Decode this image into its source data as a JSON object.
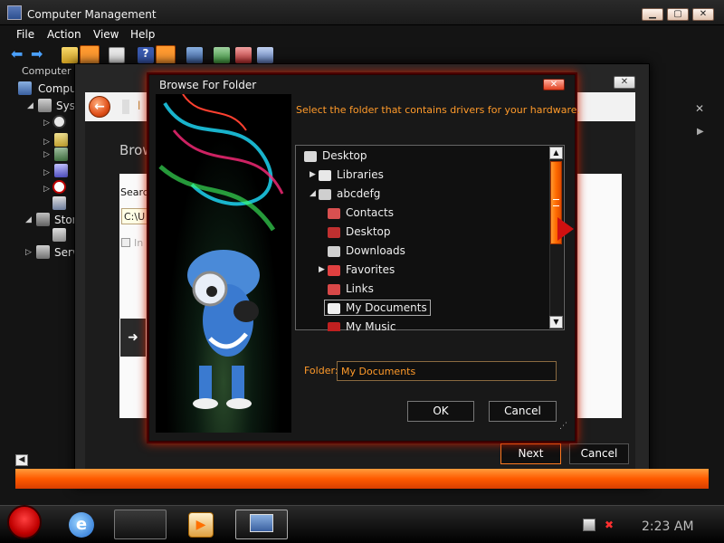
{
  "window": {
    "title": "Computer Management"
  },
  "menu": [
    "File",
    "Action",
    "View",
    "Help"
  ],
  "tree": {
    "items": [
      {
        "label": "Computer"
      },
      {
        "label": "Compu"
      },
      {
        "label": "Syst"
      },
      {
        "label": "Stor"
      },
      {
        "label": "Serv"
      }
    ]
  },
  "wizard": {
    "browse_text": "Brow",
    "search_text": "Search",
    "path_value": "C:\\U",
    "include_text": "In",
    "header_text": "l",
    "next_label": "Next",
    "cancel_label": "Cancel"
  },
  "dialog": {
    "title": "Browse For Folder",
    "prompt": "Select the folder that contains drivers for your hardware.",
    "folders": [
      {
        "label": "Desktop",
        "level": 0,
        "expander": "",
        "selected": false,
        "color": "#d9d9d9"
      },
      {
        "label": "Libraries",
        "level": 1,
        "expander": "collapsed",
        "selected": false,
        "color": "#e8e8e8"
      },
      {
        "label": "abcdefg",
        "level": 1,
        "expander": "expanded",
        "selected": false,
        "color": "#cfcfcf"
      },
      {
        "label": "Contacts",
        "level": 2,
        "expander": "",
        "selected": false,
        "color": "#d85050"
      },
      {
        "label": "Desktop",
        "level": 2,
        "expander": "",
        "selected": false,
        "color": "#c03030"
      },
      {
        "label": "Downloads",
        "level": 2,
        "expander": "",
        "selected": false,
        "color": "#d0d0d0"
      },
      {
        "label": "Favorites",
        "level": 2,
        "expander": "collapsed",
        "selected": false,
        "color": "#e04040"
      },
      {
        "label": "Links",
        "level": 2,
        "expander": "",
        "selected": false,
        "color": "#d84848"
      },
      {
        "label": "My Documents",
        "level": 2,
        "expander": "",
        "selected": true,
        "color": "#f0f0f0"
      },
      {
        "label": "My Music",
        "level": 2,
        "expander": "",
        "selected": false,
        "color": "#c02020"
      }
    ],
    "folder_label": "Folder:",
    "folder_value": "My Documents",
    "ok_label": "OK",
    "cancel_label": "Cancel"
  },
  "taskbar": {
    "clock": "2:23 AM"
  },
  "colors": {
    "accent": "#ff7a00",
    "prompt": "#ff9a2a",
    "frame_glow": "#c82000"
  }
}
